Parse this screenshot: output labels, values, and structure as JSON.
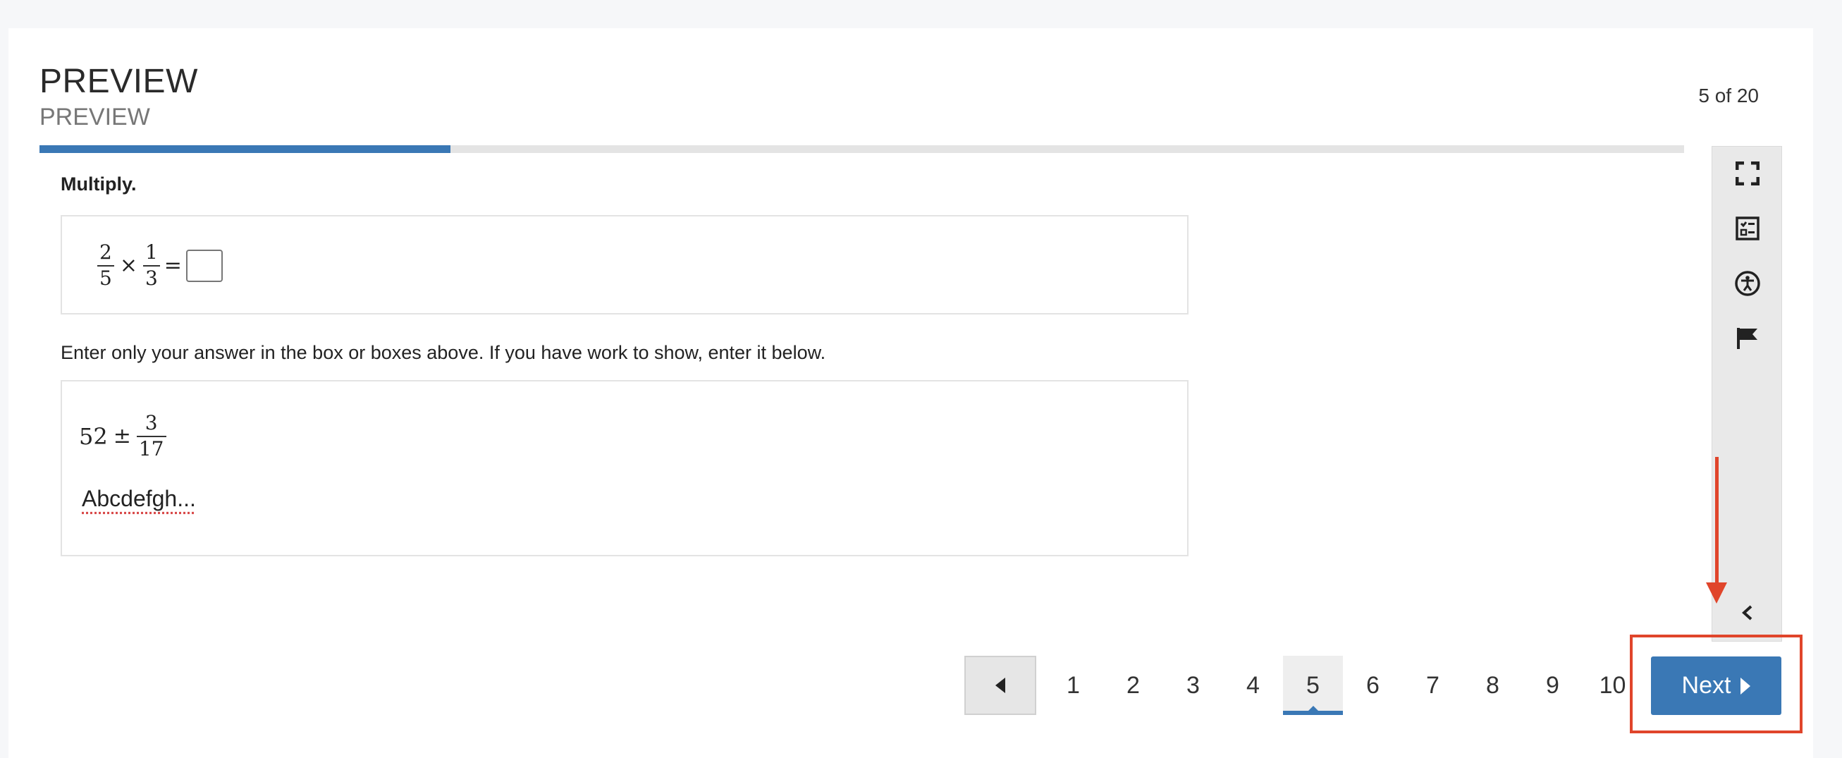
{
  "header": {
    "title": "PREVIEW",
    "subtitle": "PREVIEW",
    "counter": "5 of 20",
    "progress_fraction": 0.25
  },
  "question": {
    "prompt": "Multiply.",
    "equation": {
      "frac1_num": "2",
      "frac1_den": "5",
      "operator": "×",
      "frac2_num": "1",
      "frac2_den": "3",
      "equals": "="
    },
    "instruction": "Enter only your answer in the box or boxes above.  If you have work to show, enter it below.",
    "work": {
      "whole": "52",
      "operator": "±",
      "frac_num": "3",
      "frac_den": "17",
      "text": "Abcdefgh..."
    }
  },
  "toolbar": {
    "icons": [
      "fullscreen-icon",
      "answer-choices-icon",
      "accessibility-icon",
      "flag-icon",
      "collapse-chevron-icon"
    ]
  },
  "pagination": {
    "pages": [
      "1",
      "2",
      "3",
      "4",
      "5",
      "6",
      "7",
      "8",
      "9",
      "10"
    ],
    "current": "5",
    "next_label": "Next"
  },
  "colors": {
    "accent": "#3a78b5",
    "highlight": "#e0452b"
  }
}
